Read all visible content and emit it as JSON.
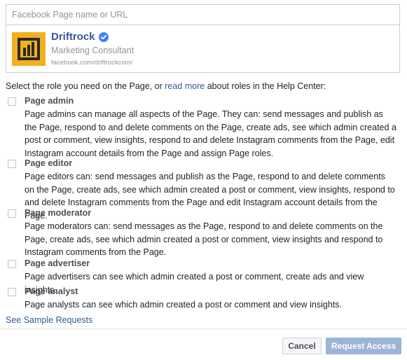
{
  "search": {
    "placeholder": "Facebook Page name or URL"
  },
  "page": {
    "name": "Driftrock",
    "category": "Marketing Consultant",
    "url": "facebook.com/driftrockcom/"
  },
  "intro": {
    "before": "Select the role you need on the Page, or ",
    "link": "read more",
    "after": " about roles in the Help Center:"
  },
  "roles": [
    {
      "title": "Page admin",
      "desc": "Page admins can manage all aspects of the Page. They can: send messages and publish as the Page, respond to and delete comments on the Page, create ads, see which admin created a post or comment, view insights, respond to and delete Instagram comments from the Page, edit Instagram account details from the Page and assign Page roles."
    },
    {
      "title": "Page editor",
      "desc": "Page editors can: send messages and publish as the Page, respond to and delete comments on the Page, create ads, see which admin created a post or comment, view insights, respond to and delete Instagram comments from the Page and edit Instagram account details from the Page."
    },
    {
      "title": "Page moderator",
      "desc": "Page moderators can: send messages as the Page, respond to and delete comments on the Page, create ads, see which admin created a post or comment, view insights and respond to Instagram comments from the Page."
    },
    {
      "title": "Page advertiser",
      "desc": "Page advertisers can see which admin created a post or comment, create ads and view insights."
    },
    {
      "title": "Page analyst",
      "desc": "Page analysts can see which admin created a post or comment and view insights."
    }
  ],
  "footer": {
    "sample_link": "See Sample Requests",
    "cancel": "Cancel",
    "request": "Request Access"
  },
  "colors": {
    "link": "#365899",
    "logo_bg": "#f2b01e",
    "verified": "#4080ff"
  }
}
